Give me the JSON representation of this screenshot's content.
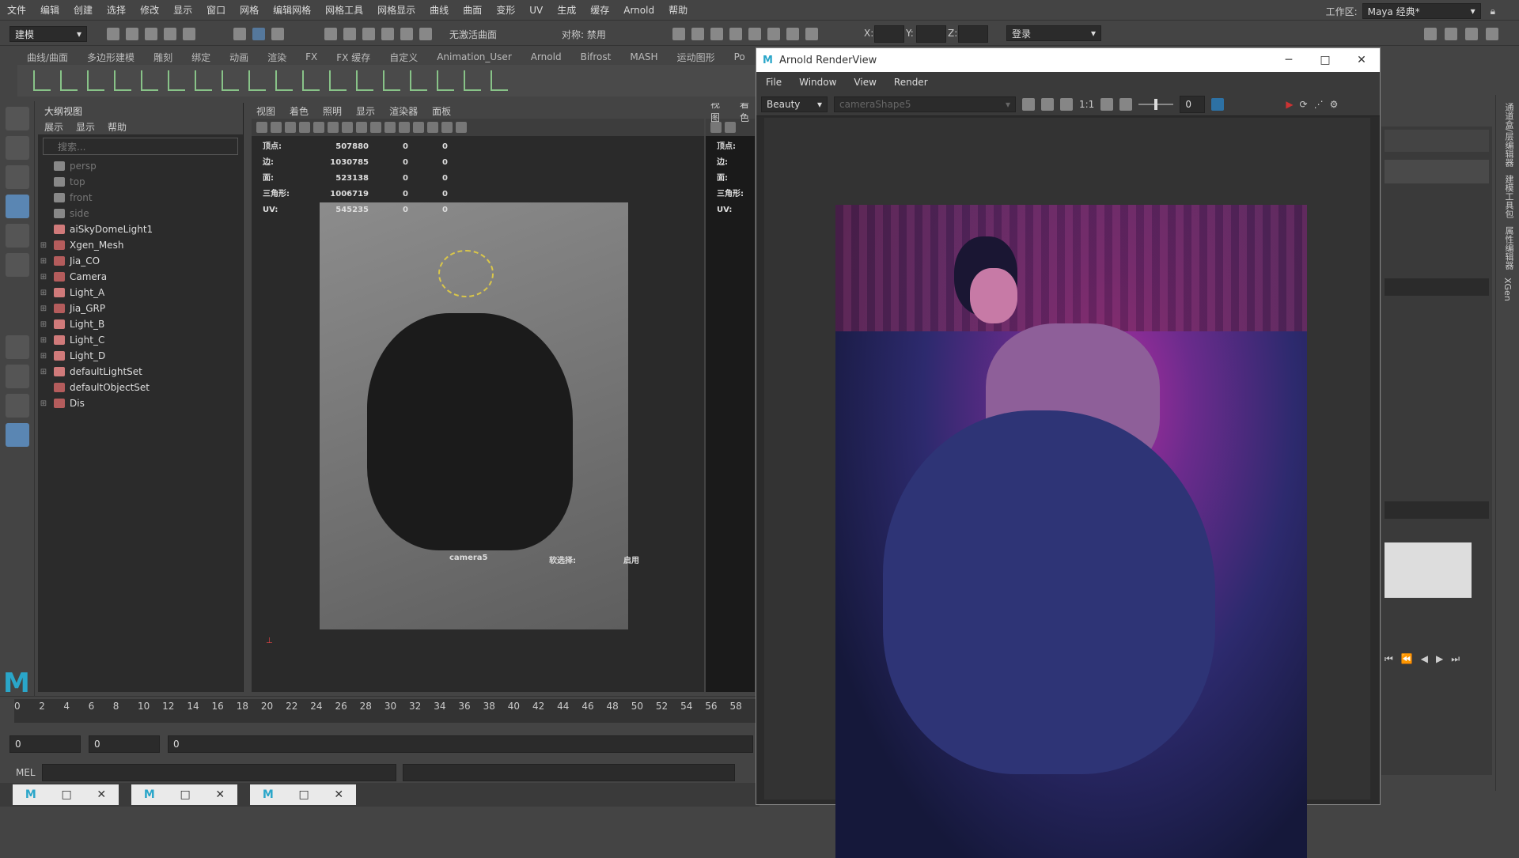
{
  "menubar": {
    "items": [
      "文件",
      "编辑",
      "创建",
      "选择",
      "修改",
      "显示",
      "窗口",
      "网格",
      "编辑网格",
      "网格工具",
      "网格显示",
      "曲线",
      "曲面",
      "变形",
      "UV",
      "生成",
      "缓存",
      "Arnold",
      "帮助"
    ],
    "workspace_label": "工作区:",
    "workspace_value": "Maya 经典*"
  },
  "statusline": {
    "mode": "建模",
    "live_surface": "无激活曲面",
    "symmetry": "对称: 禁用",
    "x_label": "X:",
    "y_label": "Y:",
    "z_label": "Z:",
    "login": "登录"
  },
  "shelf": {
    "tabs": [
      "曲线/曲面",
      "多边形建模",
      "雕刻",
      "绑定",
      "动画",
      "渲染",
      "FX",
      "FX 缓存",
      "自定义",
      "Animation_User",
      "Arnold",
      "Bifrost",
      "MASH",
      "运动图形",
      "Po"
    ]
  },
  "outliner": {
    "title": "大纲视图",
    "menu": [
      "展示",
      "显示",
      "帮助"
    ],
    "search_placeholder": "搜索...",
    "items": [
      {
        "label": "persp",
        "dim": true,
        "expand": ""
      },
      {
        "label": "top",
        "dim": true,
        "expand": ""
      },
      {
        "label": "front",
        "dim": true,
        "expand": ""
      },
      {
        "label": "side",
        "dim": true,
        "expand": ""
      },
      {
        "label": "aiSkyDomeLight1",
        "dim": false,
        "expand": ""
      },
      {
        "label": "Xgen_Mesh",
        "dim": false,
        "expand": "⊞"
      },
      {
        "label": "Jia_CO",
        "dim": false,
        "expand": "⊞"
      },
      {
        "label": "Camera",
        "dim": false,
        "expand": "⊞"
      },
      {
        "label": "Light_A",
        "dim": false,
        "expand": "⊞"
      },
      {
        "label": "Jia_GRP",
        "dim": false,
        "expand": "⊞"
      },
      {
        "label": "Light_B",
        "dim": false,
        "expand": "⊞"
      },
      {
        "label": "Light_C",
        "dim": false,
        "expand": "⊞"
      },
      {
        "label": "Light_D",
        "dim": false,
        "expand": "⊞"
      },
      {
        "label": "defaultLightSet",
        "dim": false,
        "expand": "⊞"
      },
      {
        "label": "defaultObjectSet",
        "dim": false,
        "expand": ""
      },
      {
        "label": "Dis",
        "dim": false,
        "expand": "⊞"
      }
    ]
  },
  "viewport": {
    "menu": [
      "视图",
      "着色",
      "照明",
      "显示",
      "渲染器",
      "面板"
    ],
    "hud": [
      {
        "label": "顶点:",
        "v1": "507880",
        "v2": "0",
        "v3": "0"
      },
      {
        "label": "边:",
        "v1": "1030785",
        "v2": "0",
        "v3": "0"
      },
      {
        "label": "面:",
        "v1": "523138",
        "v2": "0",
        "v3": "0"
      },
      {
        "label": "三角形:",
        "v1": "1006719",
        "v2": "0",
        "v3": "0"
      },
      {
        "label": "UV:",
        "v1": "545235",
        "v2": "0",
        "v3": "0"
      }
    ],
    "camera": "camera5",
    "soft_select_label": "软选择:",
    "soft_select_value": "启用"
  },
  "viewport2": {
    "menu": [
      "视图",
      "着色"
    ],
    "hud_labels": [
      "顶点:",
      "边:",
      "面:",
      "三角形:",
      "UV:"
    ]
  },
  "timeline": {
    "ticks": [
      "0",
      "2",
      "4",
      "6",
      "8",
      "10",
      "12",
      "14",
      "16",
      "18",
      "20",
      "22",
      "24",
      "26",
      "28",
      "30",
      "32",
      "34",
      "36",
      "38",
      "40",
      "42",
      "44",
      "46",
      "48",
      "50",
      "52",
      "54",
      "56",
      "58"
    ]
  },
  "range": {
    "start": "0",
    "end": "0",
    "current": "0"
  },
  "mel": {
    "label": "MEL"
  },
  "renderview": {
    "title": "Arnold RenderView",
    "menu": [
      "File",
      "Window",
      "View",
      "Render"
    ],
    "aov": "Beauty",
    "camera": "cameraShape5",
    "ratio": "1:1",
    "exposure": "0"
  },
  "right_strip": {
    "tabs": [
      "通道盒/层编辑器",
      "建模工具包",
      "属性编辑器",
      "XGen"
    ]
  },
  "colors": {
    "accent": "#5a86b3",
    "maya_blue": "#2aa6c9",
    "background": "#444444"
  }
}
